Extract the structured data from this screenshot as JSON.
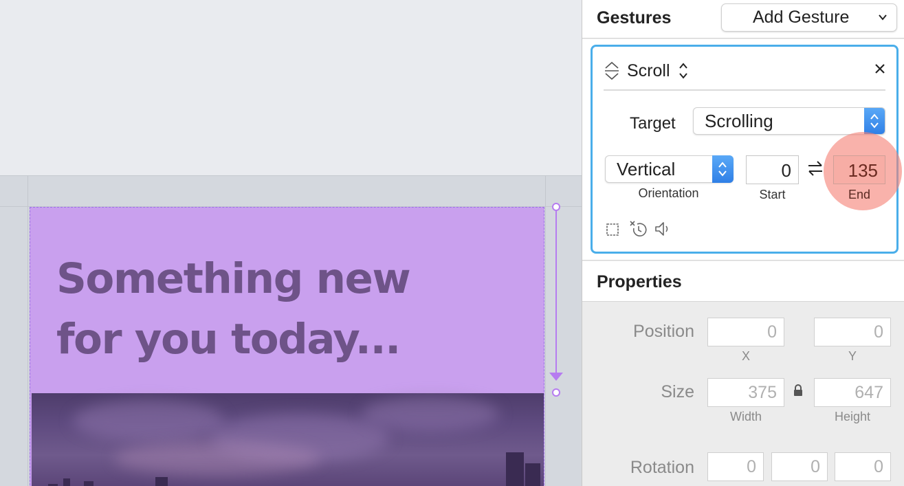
{
  "canvas": {
    "headline": [
      "Something new",
      "for you today..."
    ]
  },
  "gestures": {
    "title": "Gestures",
    "add_gesture_label": "Add Gesture",
    "card": {
      "gesture_type": "Scroll",
      "target_label": "Target",
      "target_value": "Scrolling",
      "orientation_value": "Vertical",
      "orientation_label": "Orientation",
      "start_value": "0",
      "start_label": "Start",
      "end_value": "135",
      "end_label": "End"
    }
  },
  "properties": {
    "title": "Properties",
    "position": {
      "label": "Position",
      "x": "0",
      "y": "0",
      "x_label": "X",
      "y_label": "Y"
    },
    "size": {
      "label": "Size",
      "width": "375",
      "height": "647",
      "width_label": "Width",
      "height_label": "Height"
    },
    "rotation": {
      "label": "Rotation",
      "values": [
        "0",
        "0",
        "0"
      ]
    }
  },
  "colors": {
    "accent_blue": "#4aaeea",
    "scroll_purple": "#b67cf0",
    "artboard_fill": "#c9a0ee",
    "headline": "#6e5388",
    "end_highlight": "#f58278"
  }
}
